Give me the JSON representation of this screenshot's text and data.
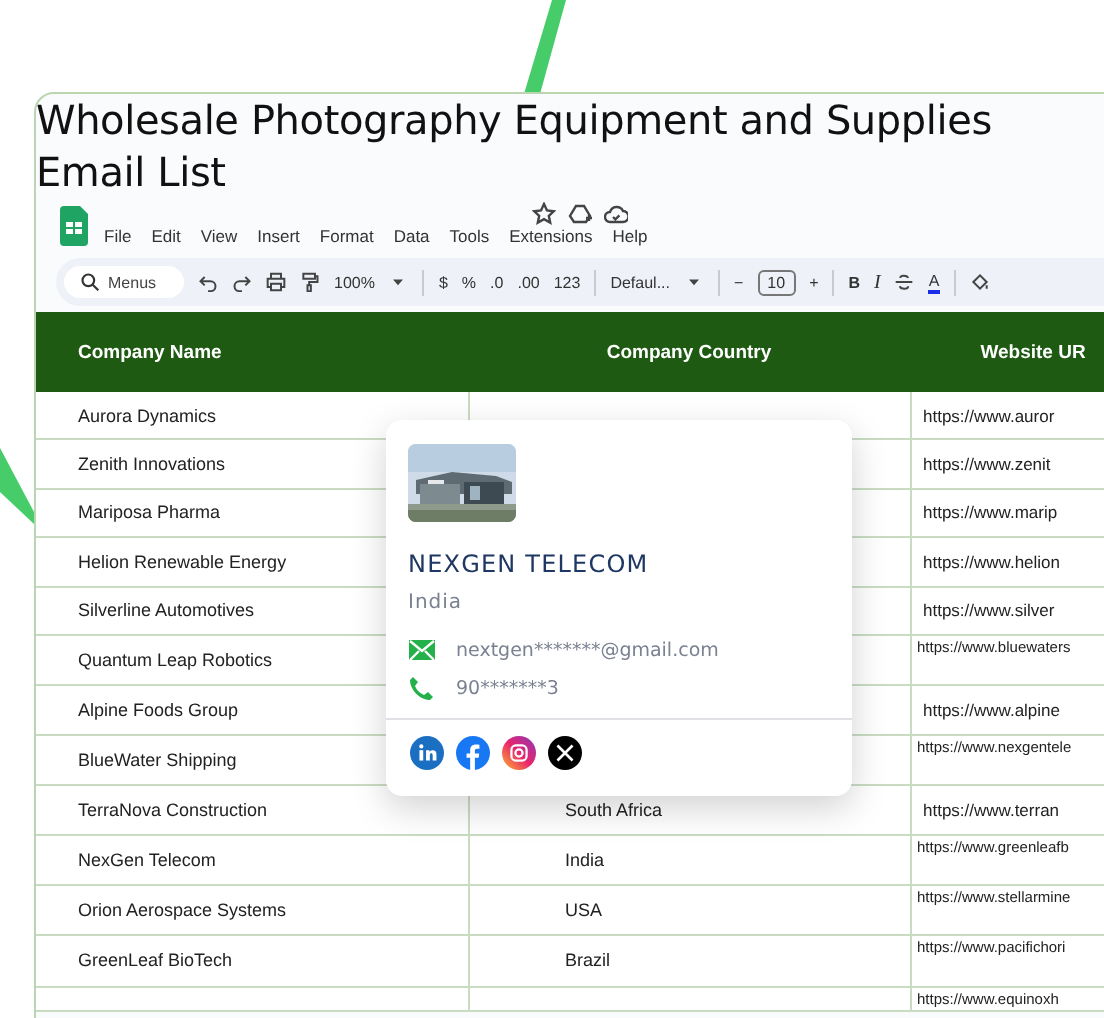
{
  "title": "Wholesale Photography Equipment and Supplies Email List",
  "menu": [
    "File",
    "Edit",
    "View",
    "Insert",
    "Format",
    "Data",
    "Tools",
    "Extensions",
    "Help"
  ],
  "toolbar": {
    "search_placeholder": "Menus",
    "zoom": "100%",
    "number_formats": [
      "$",
      "%",
      ".0",
      ".00",
      "123"
    ],
    "font": "Defaul...",
    "minus": "−",
    "font_size": "10",
    "plus": "+",
    "bold": "B",
    "italic": "I",
    "text_color": "A"
  },
  "table": {
    "columns": [
      "Company Name",
      "Company Country",
      "Website UR"
    ],
    "rows": [
      {
        "company": "Aurora Dynamics",
        "website": "https://www.auror",
        "compact": false
      },
      {
        "company": "Zenith Innovations",
        "website": "https://www.zenit",
        "compact": false
      },
      {
        "company": "Mariposa Pharma",
        "website": "https://www.marip",
        "compact": false
      },
      {
        "company": "Helion Renewable Energy",
        "website": "https://www.helion",
        "compact": false
      },
      {
        "company": "Silverline Automotives",
        "website": "https://www.silver",
        "compact": false
      },
      {
        "company": "Quantum Leap Robotics",
        "website": "https://www.bluewaters",
        "compact": true
      },
      {
        "company": "Alpine Foods Group",
        "website": "https://www.alpine",
        "compact": false
      },
      {
        "company": "BlueWater Shipping",
        "website": "https://www.nexgentele",
        "compact": true
      },
      {
        "company": "TerraNova Construction",
        "country": "South Africa",
        "website": "https://www.terran",
        "compact": false
      },
      {
        "company": "NexGen Telecom",
        "country": "India",
        "website": "https://www.greenleafb",
        "compact": true
      },
      {
        "company": "Orion Aerospace Systems",
        "country": "USA",
        "website": "https://www.stellarmine",
        "compact": true
      },
      {
        "company": "GreenLeaf BioTech",
        "country": "Brazil",
        "website": "https://www.pacifichori",
        "compact": true
      },
      {
        "website": "https://www.equinoxh",
        "compact": true
      }
    ]
  },
  "popup": {
    "name": "NEXGEN TELECOM",
    "country": "India",
    "email": "nextgen*******@gmail.com",
    "phone": "90*******3"
  }
}
